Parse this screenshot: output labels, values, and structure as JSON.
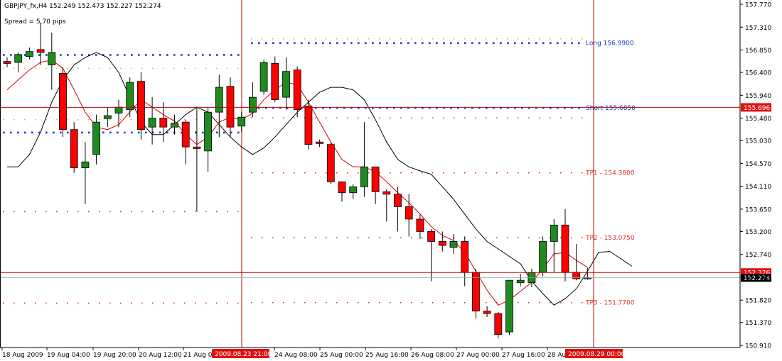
{
  "header": {
    "symbol_line": "GBPJPY_fx,H4  152.249 152.473 152.227 152.274",
    "spread_line": "Spread = 5.70 pips"
  },
  "colors": {
    "bull": "#1f8a1f",
    "bear": "#ff0000",
    "ma_fast": "#d40000",
    "ma_slow": "#000000",
    "level_line": "#c00000",
    "long_dots": "#1a3cc8",
    "tp_dots": "#e03030",
    "label_box": "#e01010",
    "frame": "#000000"
  },
  "chart_data": {
    "type": "candlestick",
    "ylim": [
      150.91,
      157.77
    ],
    "y_ticks": [
      "157.770",
      "157.310",
      "156.850",
      "156.400",
      "155.940",
      "155.480",
      "155.030",
      "154.570",
      "154.110",
      "153.650",
      "153.200",
      "152.740",
      "152.280",
      "151.820",
      "151.370",
      "150.910"
    ],
    "x_ticks": [
      "18 Aug 2009",
      "19 Aug 04:00",
      "19 Aug 20:00",
      "20 Aug 12:00",
      "21 Aug 04:00",
      "24 Aug 08:00",
      "25 Aug 00:00",
      "25 Aug 16:00",
      "26 Aug 08:00",
      "27 Aug 00:00",
      "27 Aug 16:00",
      "28 Au"
    ],
    "x_highlights": [
      "2009.08.23 21:00",
      "2009.08.29 00:00"
    ],
    "candles": [
      [
        156.62,
        156.58,
        156.7,
        156.5
      ],
      [
        156.6,
        156.76,
        156.8,
        156.4
      ],
      [
        156.72,
        156.82,
        156.9,
        156.66
      ],
      [
        156.86,
        156.8,
        157.4,
        156.55
      ],
      [
        156.55,
        156.8,
        157.2,
        156.05
      ],
      [
        156.38,
        155.25,
        156.5,
        155.1
      ],
      [
        155.25,
        154.48,
        155.4,
        154.38
      ],
      [
        154.48,
        154.6,
        155.0,
        153.75
      ],
      [
        154.75,
        155.4,
        155.55,
        154.55
      ],
      [
        155.47,
        155.53,
        155.7,
        155.3
      ],
      [
        155.58,
        155.7,
        155.85,
        155.3
      ],
      [
        155.65,
        156.2,
        156.3,
        155.5
      ],
      [
        156.22,
        155.25,
        156.4,
        155.05
      ],
      [
        155.3,
        155.48,
        155.9,
        154.95
      ],
      [
        155.48,
        155.3,
        155.8,
        155.0
      ],
      [
        155.3,
        155.38,
        155.55,
        155.15
      ],
      [
        155.4,
        154.9,
        155.45,
        154.55
      ],
      [
        154.9,
        154.87,
        155.7,
        153.6
      ],
      [
        154.82,
        155.6,
        155.7,
        154.4
      ],
      [
        155.6,
        156.1,
        156.35,
        155.1
      ],
      [
        156.12,
        155.3,
        156.3,
        155.1
      ],
      [
        155.32,
        155.5,
        155.6,
        155.2
      ],
      [
        155.6,
        155.9,
        156.2,
        155.5
      ],
      [
        156.02,
        156.6,
        156.65,
        155.95
      ],
      [
        156.58,
        155.85,
        156.72,
        155.8
      ],
      [
        155.9,
        156.42,
        156.7,
        155.65
      ],
      [
        156.45,
        155.65,
        156.52,
        155.5
      ],
      [
        155.72,
        154.95,
        155.85,
        154.85
      ],
      [
        155.0,
        154.97,
        155.05,
        154.9
      ],
      [
        154.95,
        154.2,
        154.98,
        154.15
      ],
      [
        154.2,
        153.98,
        154.2,
        153.8
      ],
      [
        153.98,
        154.1,
        154.15,
        153.85
      ],
      [
        154.1,
        154.5,
        155.4,
        153.9
      ],
      [
        154.5,
        154.0,
        154.5,
        153.75
      ],
      [
        154.0,
        153.95,
        154.05,
        153.4
      ],
      [
        153.95,
        153.7,
        154.1,
        153.2
      ],
      [
        153.7,
        153.45,
        153.95,
        153.1
      ],
      [
        153.45,
        153.2,
        153.55,
        153.05
      ],
      [
        153.2,
        153.0,
        153.25,
        152.2
      ],
      [
        153.0,
        152.92,
        153.2,
        152.8
      ],
      [
        152.88,
        153.0,
        153.15,
        152.75
      ],
      [
        153.0,
        152.38,
        153.1,
        152.1
      ],
      [
        152.38,
        151.6,
        152.45,
        151.45
      ],
      [
        151.6,
        151.55,
        151.7,
        151.48
      ],
      [
        151.55,
        151.13,
        151.58,
        151.05
      ],
      [
        151.18,
        152.22,
        152.22,
        151.12
      ],
      [
        152.17,
        152.22,
        152.35,
        152.1
      ],
      [
        152.17,
        152.37,
        152.45,
        152.08
      ],
      [
        152.38,
        153.0,
        153.1,
        152.3
      ],
      [
        153.0,
        153.33,
        153.45,
        152.38
      ],
      [
        153.33,
        152.38,
        153.65,
        152.2
      ],
      [
        152.38,
        152.25,
        152.95,
        152.22
      ],
      [
        152.25,
        152.27,
        152.47,
        152.23
      ]
    ],
    "ma_fast": [
      [
        0,
        156.05
      ],
      [
        1,
        156.25
      ],
      [
        2,
        156.45
      ],
      [
        3,
        156.6
      ],
      [
        4,
        156.65
      ],
      [
        5,
        156.48
      ],
      [
        6,
        156.05
      ],
      [
        7,
        155.6
      ],
      [
        8,
        155.3
      ],
      [
        9,
        155.25
      ],
      [
        10,
        155.35
      ],
      [
        11,
        155.6
      ],
      [
        12,
        155.85
      ],
      [
        13,
        155.7
      ],
      [
        14,
        155.55
      ],
      [
        15,
        155.42
      ],
      [
        16,
        155.15
      ],
      [
        17,
        154.95
      ],
      [
        18,
        155.1
      ],
      [
        19,
        155.4
      ],
      [
        20,
        155.5
      ],
      [
        21,
        155.45
      ],
      [
        22,
        155.58
      ],
      [
        23,
        155.85
      ],
      [
        24,
        156.05
      ],
      [
        25,
        156.2
      ],
      [
        26,
        156.15
      ],
      [
        27,
        155.8
      ],
      [
        28,
        155.4
      ],
      [
        29,
        155.0
      ],
      [
        30,
        154.65
      ],
      [
        31,
        154.5
      ],
      [
        32,
        154.5
      ],
      [
        33,
        154.4
      ],
      [
        34,
        154.2
      ],
      [
        35,
        153.98
      ],
      [
        36,
        153.78
      ],
      [
        37,
        153.55
      ],
      [
        38,
        153.3
      ],
      [
        39,
        153.12
      ],
      [
        40,
        153.02
      ],
      [
        41,
        152.78
      ],
      [
        42,
        152.4
      ],
      [
        43,
        152.02
      ],
      [
        44,
        151.72
      ],
      [
        45,
        151.82
      ],
      [
        46,
        152.0
      ],
      [
        47,
        152.18
      ],
      [
        48,
        152.45
      ],
      [
        49,
        152.75
      ],
      [
        50,
        152.78
      ],
      [
        51,
        152.62
      ],
      [
        52,
        152.48
      ]
    ],
    "ma_slow": [
      [
        0,
        154.5
      ],
      [
        1,
        154.5
      ],
      [
        2,
        154.75
      ],
      [
        3,
        155.2
      ],
      [
        4,
        155.8
      ],
      [
        5,
        156.25
      ],
      [
        6,
        156.55
      ],
      [
        7,
        156.7
      ],
      [
        8,
        156.8
      ],
      [
        9,
        156.7
      ],
      [
        10,
        156.4
      ],
      [
        11,
        155.9
      ],
      [
        12,
        155.4
      ],
      [
        13,
        155.15
      ],
      [
        14,
        155.15
      ],
      [
        15,
        155.35
      ],
      [
        16,
        155.55
      ],
      [
        17,
        155.7
      ],
      [
        18,
        155.6
      ],
      [
        19,
        155.35
      ],
      [
        20,
        155.1
      ],
      [
        21,
        154.9
      ],
      [
        22,
        154.75
      ],
      [
        23,
        154.88
      ],
      [
        24,
        155.1
      ],
      [
        25,
        155.35
      ],
      [
        26,
        155.6
      ],
      [
        27,
        155.8
      ],
      [
        28,
        156.0
      ],
      [
        29,
        156.1
      ],
      [
        30,
        156.1
      ],
      [
        31,
        156.05
      ],
      [
        32,
        155.85
      ],
      [
        33,
        155.45
      ],
      [
        34,
        155.0
      ],
      [
        35,
        154.65
      ],
      [
        36,
        154.5
      ],
      [
        37,
        154.42
      ],
      [
        38,
        154.35
      ],
      [
        39,
        154.1
      ],
      [
        40,
        153.85
      ],
      [
        41,
        153.55
      ],
      [
        42,
        153.25
      ],
      [
        43,
        153.0
      ],
      [
        44,
        152.85
      ],
      [
        45,
        152.7
      ],
      [
        46,
        152.55
      ],
      [
        47,
        152.2
      ],
      [
        48,
        151.95
      ],
      [
        49,
        151.72
      ],
      [
        50,
        151.85
      ],
      [
        51,
        152.05
      ],
      [
        52,
        152.4
      ],
      [
        53,
        152.78
      ],
      [
        54,
        152.8
      ],
      [
        55,
        152.65
      ],
      [
        56,
        152.5
      ]
    ],
    "horizontal_lines": [
      {
        "value": 155.696,
        "label": "155.696"
      },
      {
        "value": 152.376,
        "label": "152.376"
      }
    ],
    "current_price": {
      "value": 152.274,
      "label": "152.274"
    },
    "vertical_lines": [
      "2009.08.23 21:00",
      "2009.08.29 00:00"
    ],
    "levels": [
      {
        "name": "Long",
        "label": "Long  156.9900",
        "value": 156.99,
        "style": "blue"
      },
      {
        "name": "Short",
        "label": "Short  155.6850",
        "value": 155.685,
        "style": "blue"
      },
      {
        "name": "TP1",
        "label": "TP1 - 154.3800",
        "value": 154.38,
        "style": "red"
      },
      {
        "name": "TP2",
        "label": "TP2 - 153.0750",
        "value": 153.075,
        "style": "red"
      },
      {
        "name": "TP3",
        "label": "TP3 - 151.7700",
        "value": 151.77,
        "style": "red"
      }
    ],
    "previous_levels": [
      {
        "value": 156.75,
        "style": "blue"
      },
      {
        "value": 156.48,
        "style": "orange"
      },
      {
        "value": 155.45,
        "style": "orange"
      },
      {
        "value": 155.19,
        "style": "blue"
      },
      {
        "value": 153.6,
        "style": "red"
      },
      {
        "value": 151.76,
        "style": "red"
      }
    ],
    "grid": false
  }
}
